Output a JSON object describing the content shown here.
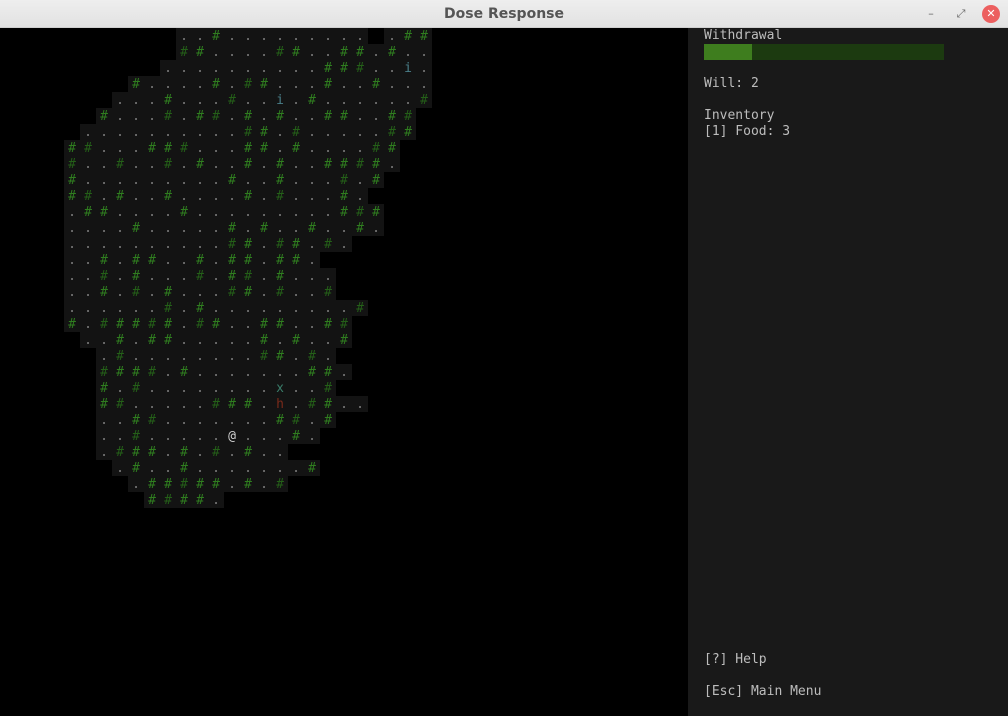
{
  "window": {
    "title": "Dose Response",
    "controls": {
      "minimize": "–",
      "maximize": "⤢",
      "close": "✕"
    }
  },
  "map": {
    "colors": {
      "floor_bg": "#131313",
      "tree": "#2f7d1f",
      "tree_dim": "#245f18",
      "dot": "#7a7a7a",
      "player": "#d0d0d0",
      "monster_h": "#7a2a1a",
      "item_x": "#3a7d6a",
      "item_i": "#4a7f8a"
    },
    "rows": [
      {
        "row": 0,
        "text": "           ..#......... .##"
      },
      {
        "row": 1,
        "text": "           ##....##..##.#.."
      },
      {
        "row": 2,
        "text": "          ..........###..i."
      },
      {
        "row": 3,
        "text": "        #....#.##...#..#..."
      },
      {
        "row": 4,
        "text": "       ...#...#..i.#......#"
      },
      {
        "row": 5,
        "text": "      #...#.##.#.#..##..##"
      },
      {
        "row": 6,
        "text": "     ..........##.#.....##"
      },
      {
        "row": 7,
        "text": "    ##...###...##.#....##"
      },
      {
        "row": 8,
        "text": "    #..#..#.#..#.#..####."
      },
      {
        "row": 9,
        "text": "    #.........#..#...#.#"
      },
      {
        "row": 10,
        "text": "    ##.#..#....#.#...#."
      },
      {
        "row": 11,
        "text": "    .##....#.........###"
      },
      {
        "row": 12,
        "text": "    ....#.....#.#..#..#."
      },
      {
        "row": 13,
        "text": "    ..........##.##.#."
      },
      {
        "row": 14,
        "text": "    ..#.##..#.##.##."
      },
      {
        "row": 15,
        "text": "    ..#.#...#.##.#..."
      },
      {
        "row": 16,
        "text": "    ..#.#.#...##.#..#"
      },
      {
        "row": 17,
        "text": "    ......#.#.........#"
      },
      {
        "row": 18,
        "text": "    #.#####.##..##..##"
      },
      {
        "row": 19,
        "text": "     ..#.##.....#.#..#"
      },
      {
        "row": 20,
        "text": "      .#........##.#."
      },
      {
        "row": 21,
        "text": "      ####.#.......##."
      },
      {
        "row": 22,
        "text": "      #.#........x..#"
      },
      {
        "row": 23,
        "text": "      ##.....###.h.##.."
      },
      {
        "row": 24,
        "text": "      ..##.......##.#"
      },
      {
        "row": 25,
        "text": "      ..#.....@...#."
      },
      {
        "row": 26,
        "text": "      .###.#.#.#.."
      },
      {
        "row": 27,
        "text": "       .#..#.......#"
      },
      {
        "row": 28,
        "text": "        .#####.#.#"
      },
      {
        "row": 29,
        "text": "         ####."
      }
    ]
  },
  "sidebar": {
    "bg": "#191919",
    "withdrawal_label": "Withdrawal",
    "withdrawal_level": 0.2,
    "will_text": "Will: 2",
    "inventory_label": "Inventory",
    "inventory_items": [
      "[1] Food: 3"
    ],
    "help_text": "[?] Help",
    "menu_text": "[Esc] Main Menu"
  }
}
